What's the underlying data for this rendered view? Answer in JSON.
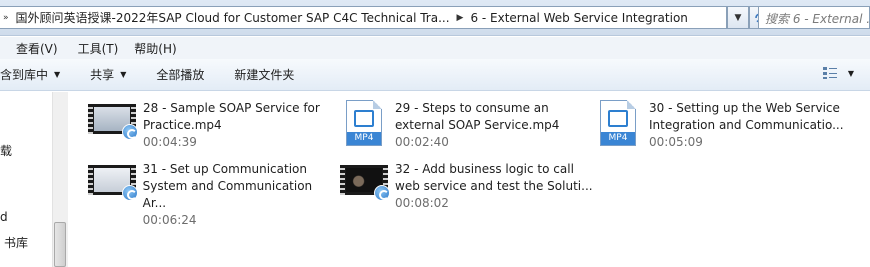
{
  "address_bar": {
    "crumbs": [
      "国外顾问英语授课-2022年SAP Cloud for Customer SAP C4C Technical Tra...",
      "6 - External Web Service Integration"
    ],
    "search_placeholder": "搜索 6 - External ..."
  },
  "menu": [
    "查看(V)",
    "工具(T)",
    "帮助(H)"
  ],
  "menu_partial": "",
  "commands": {
    "include_in_library": "含到库中",
    "share": "共享",
    "play_all": "全部播放",
    "new_folder": "新建文件夹"
  },
  "nav": {
    "partial_items": [
      "载",
      "d",
      "书库"
    ]
  },
  "files": [
    {
      "name_line1": "28 - Sample SOAP Service for",
      "name_line2": "Practice.mp4",
      "duration": "00:04:39",
      "kind": "video"
    },
    {
      "name_line1": "29 - Steps to consume an",
      "name_line2": "external SOAP Service.mp4",
      "duration": "00:02:40",
      "kind": "mp4",
      "badge": "MP4"
    },
    {
      "name_line1": "30 - Setting up the Web Service",
      "name_line2": "Integration and Communicatio...",
      "duration": "00:05:09",
      "kind": "mp4",
      "badge": "MP4"
    },
    {
      "name_line1": "31 - Set up Communication",
      "name_line2": "System and Communication Ar...",
      "duration": "00:06:24",
      "kind": "video"
    },
    {
      "name_line1": "32 - Add business logic to call",
      "name_line2": "web service and test the Soluti...",
      "duration": "00:08:02",
      "kind": "video-dark"
    }
  ],
  "colors": {
    "accent": "#2b78c8",
    "mp4_strip": "#3a85d4",
    "duration_text": "#6d6d6d"
  }
}
